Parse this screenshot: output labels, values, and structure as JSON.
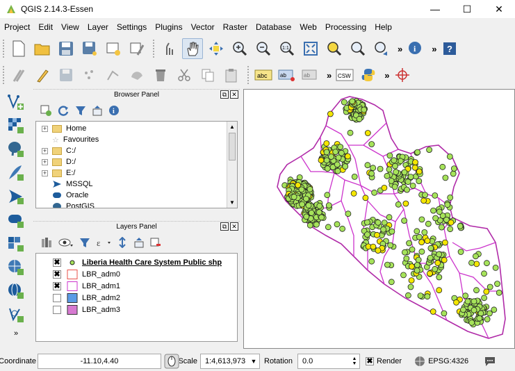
{
  "window": {
    "title": "QGIS 2.14.3-Essen",
    "minimize": "—",
    "maximize": "☐",
    "close": "✕"
  },
  "menu": [
    "Project",
    "Edit",
    "View",
    "Layer",
    "Settings",
    "Plugins",
    "Vector",
    "Raster",
    "Database",
    "Web",
    "Processing",
    "Help"
  ],
  "toolbar": {
    "overflow": "»"
  },
  "browser_panel": {
    "title": "Browser Panel",
    "items": [
      {
        "label": "Home",
        "type": "folder",
        "expandable": true
      },
      {
        "label": "Favourites",
        "type": "star",
        "expandable": false
      },
      {
        "label": "C:/",
        "type": "folder",
        "expandable": true
      },
      {
        "label": "D:/",
        "type": "folder",
        "expandable": true
      },
      {
        "label": "E:/",
        "type": "folder",
        "expandable": true
      },
      {
        "label": "MSSQL",
        "type": "db",
        "expandable": false
      },
      {
        "label": "Oracle",
        "type": "db",
        "expandable": false
      },
      {
        "label": "PostGIS",
        "type": "db",
        "expandable": false
      }
    ]
  },
  "layers_panel": {
    "title": "Layers Panel",
    "layers": [
      {
        "name": "Liberia Health Care System Public shp",
        "checked": true,
        "symbol": "point",
        "color": "#a6e35a"
      },
      {
        "name": "LBR_adm0",
        "checked": true,
        "symbol": "outline",
        "color": "#e8524a"
      },
      {
        "name": "LBR_adm1",
        "checked": true,
        "symbol": "outline",
        "color": "#cc33cc"
      },
      {
        "name": "LBR_adm2",
        "checked": false,
        "symbol": "fill",
        "color": "#5b9be6"
      },
      {
        "name": "LBR_adm3",
        "checked": false,
        "symbol": "fill",
        "color": "#d77ad1"
      }
    ]
  },
  "status": {
    "coordinate_label": "Coordinate",
    "coordinate_value": "-11.10,4.40",
    "scale_label": "Scale",
    "scale_value": "1:4,613,973",
    "rotation_label": "Rotation",
    "rotation_value": "0.0",
    "render_label": "Render",
    "render_checked": true,
    "crs": "EPSG:4326"
  },
  "colors": {
    "boundary": "#cc33cc",
    "country": "#b02aa8",
    "point_green": "#a6e35a",
    "point_yellow": "#f4e600",
    "point_outline": "#222222"
  }
}
